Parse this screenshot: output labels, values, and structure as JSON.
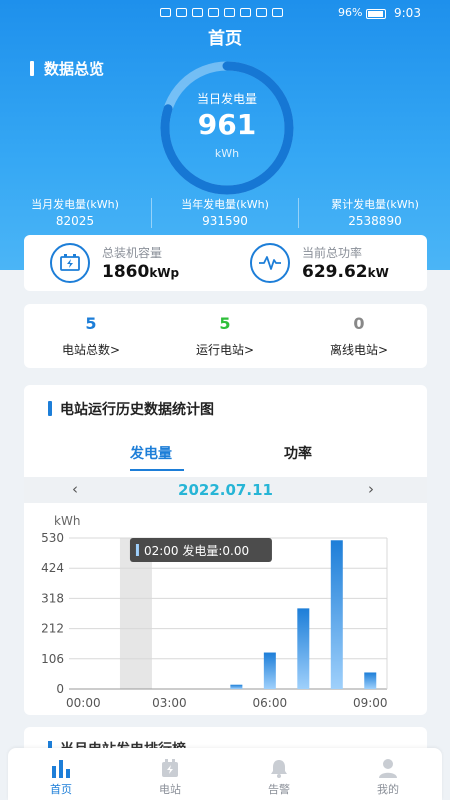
{
  "status_bar": {
    "battery_pct": "96%",
    "time": "9:03"
  },
  "header": {
    "title": "首页",
    "overview_label": "数据总览"
  },
  "daily": {
    "label": "当日发电量",
    "value": "961",
    "unit": "kWh",
    "ring_progress": 0.8
  },
  "stats": [
    {
      "label": "当月发电量(kWh)",
      "value": "82025"
    },
    {
      "label": "当年发电量(kWh)",
      "value": "931590"
    },
    {
      "label": "累计发电量(kWh)",
      "value": "2538890"
    }
  ],
  "capacity": {
    "installed_label": "总装机容量",
    "installed_value": "1860",
    "installed_unit": "kWp",
    "power_label": "当前总功率",
    "power_value": "629.62",
    "power_unit": "kW"
  },
  "counts": [
    {
      "value": "5",
      "label": "电站总数>",
      "color": "#1d7ed8"
    },
    {
      "value": "5",
      "label": "运行电站>",
      "color": "#2fbf3a"
    },
    {
      "value": "0",
      "label": "离线电站>",
      "color": "#888888"
    }
  ],
  "chart_card": {
    "title": "电站运行历史数据统计图",
    "tab_energy": "发电量",
    "tab_power": "功率",
    "date": "2022.07.11",
    "prev_arrow": "‹",
    "next_arrow": "›",
    "tooltip": "02:00 发电量:0.00"
  },
  "chart_data": {
    "type": "bar",
    "ylabel": "kWh",
    "ylim": [
      0,
      530
    ],
    "yticks": [
      "530",
      "424",
      "318",
      "212",
      "106",
      "0"
    ],
    "xticks": [
      "00:00",
      "03:00",
      "06:00",
      "09:00"
    ],
    "xlim": [
      0,
      9.5
    ],
    "x": [
      5,
      6,
      7,
      8,
      9
    ],
    "values": [
      15,
      128,
      283,
      522,
      58
    ],
    "highlight_x": 2,
    "series_color": "#1d7ed8"
  },
  "next_section": {
    "title": "当月电站发电排行榜"
  },
  "bottom_nav": [
    {
      "label": "首页",
      "icon": "bar-chart-icon"
    },
    {
      "label": "电站",
      "icon": "station-icon"
    },
    {
      "label": "告警",
      "icon": "bell-icon"
    },
    {
      "label": "我的",
      "icon": "user-icon"
    }
  ]
}
